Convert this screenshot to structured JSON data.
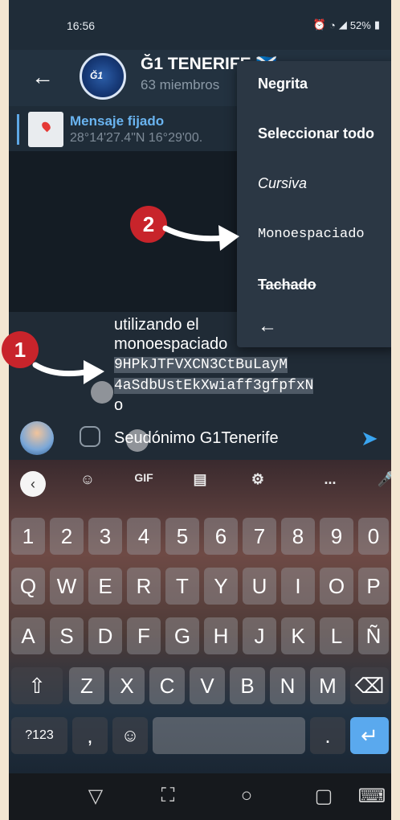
{
  "status": {
    "time": "16:56",
    "battery": "52%"
  },
  "chat": {
    "title": "Ğ1 TENERIFE 🏴󠁧󠁢󠁳󠁣󠁴󠁿",
    "subtitle": "63 miembros",
    "avatar_text": "Ğ1"
  },
  "pinned": {
    "label": "Mensaje fijado",
    "text": "28°14'27.4\"N 16°29'00."
  },
  "message": {
    "line1": "utilizando el ",
    "line2": "monoespaciado",
    "mono1": "9HPkJTFVXCN3CtBuLayM",
    "mono2": "4aSdbUstEkXwiaff3gfpfxN",
    "mono3": "o",
    "signature": "Seudónimo G1Tenerife"
  },
  "menu": {
    "items": [
      "Negrita",
      "Seleccionar todo",
      "Cursiva",
      "Monoespaciado",
      "Tachado"
    ],
    "back": "←"
  },
  "annotations": {
    "one": "1",
    "two": "2"
  },
  "keyboard": {
    "toolbar": {
      "gif": "GIF",
      "more": "..."
    },
    "row_numbers": [
      "1",
      "2",
      "3",
      "4",
      "5",
      "6",
      "7",
      "8",
      "9",
      "0"
    ],
    "row_q": [
      "Q",
      "W",
      "E",
      "R",
      "T",
      "Y",
      "U",
      "I",
      "O",
      "P"
    ],
    "row_a": [
      "A",
      "S",
      "D",
      "F",
      "G",
      "H",
      "J",
      "K",
      "L",
      "Ñ"
    ],
    "row_z": [
      "Z",
      "X",
      "C",
      "V",
      "B",
      "N",
      "M"
    ],
    "symbols": "?123",
    "comma": ",",
    "period": ".",
    "enter": "↵"
  },
  "colors": {
    "accent": "#3aa5f0",
    "annotation": "#c8242b",
    "menu_bg": "#2b3744"
  }
}
